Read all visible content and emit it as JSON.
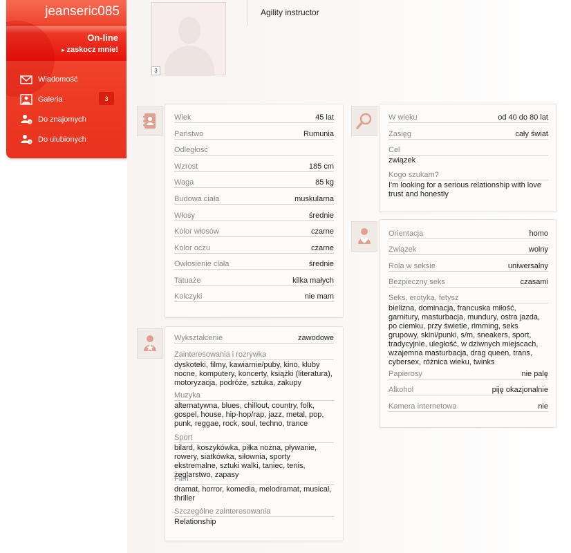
{
  "sidebar": {
    "username": "jeanseric085",
    "status": "On-line",
    "surprise_label": "zaskocz mnie!",
    "items": [
      {
        "label": "Wiadomość",
        "icon": "envelope-icon"
      },
      {
        "label": "Galeria",
        "icon": "picture-icon",
        "badge": "3"
      },
      {
        "label": "Do znajomych",
        "icon": "add-friend-icon"
      },
      {
        "label": "Do ulubionych",
        "icon": "add-favorite-icon"
      }
    ]
  },
  "profile": {
    "photo_count": "3",
    "headline": "Agility instructor"
  },
  "details": {
    "rows": [
      {
        "label": "Wiek",
        "value": "45 lat"
      },
      {
        "label": "Państwo",
        "value": "Rumunia"
      },
      {
        "label": "Odległość",
        "value": ""
      },
      {
        "label": "Wzrost",
        "value": "185 cm"
      },
      {
        "label": "Waga",
        "value": "85 kg"
      },
      {
        "label": "Budowa ciała",
        "value": "muskularna"
      },
      {
        "label": "Włosy",
        "value": "średnie"
      },
      {
        "label": "Kolor włosów",
        "value": "czarne"
      },
      {
        "label": "Kolor oczu",
        "value": "czarne"
      },
      {
        "label": "Owłosienie ciała",
        "value": "średnie"
      },
      {
        "label": "Tatuaże",
        "value": "kilka małych"
      },
      {
        "label": "Kolczyki",
        "value": "nie mam"
      }
    ]
  },
  "search": {
    "age_label": "W wieku",
    "age_value": "od 40 do 80 lat",
    "range_label": "Zasięg",
    "range_value": "cały świat",
    "goal_label": "Cel",
    "goal_value": "związek",
    "looking_label": "Kogo szukam?",
    "looking_value": "I'm looking for a serious relationship with love trust and honestly"
  },
  "sexuality": {
    "orientation_label": "Orientacja",
    "orientation_value": "homo",
    "relationship_label": "Związek",
    "relationship_value": "wolny",
    "role_label": "Rola w seksie",
    "role_value": "uniwersalny",
    "safe_label": "Bezpieczny seks",
    "safe_value": "czasami",
    "fetish_label": "Seks, erotyka, fetysz",
    "fetish_value": "bielizna, dominacja, francuska miłość, garnitury, masturbacja, mundury, ostra jazda, po ciemku, przy świetle, rimming, seks grupowy, skini/punki, s/m, sneakers, sport, tradycyjnie, uległość, w dziwnych miejscach, wzajemna masturbacja, drag queen, trans, cybersex, różnica wieku, twinks",
    "cigarettes_label": "Papierosy",
    "cigarettes_value": "nie palę",
    "alcohol_label": "Alkohol",
    "alcohol_value": "piję okazjonalnie",
    "webcam_label": "Kamera internetowa",
    "webcam_value": "nie"
  },
  "interests": {
    "education_label": "Wykształcenie",
    "education_value": "zawodowe",
    "hobbies_label": "Zainteresowania i rozrywka",
    "hobbies_value": "dyskoteki, filmy, kawiarnie/puby, kino, kluby nocne, komputery, koncerty, książki (literatura), motoryzacja, podróże, sztuka, zakupy",
    "music_label": "Muzyka",
    "music_value": "alternatywna, blues, chillout, country, folk, gospel, house, hip-hop/rap, jazz, metal, pop, punk, reggae, rock, soul, techno, trance",
    "sport_label": "Sport",
    "sport_value": "bilard, koszykówka, piłka nożna, pływanie, rowery, siatkówka, siłownia, sporty ekstremalne, sztuki walki, taniec, tenis, żeglarstwo, zapasy",
    "film_label": "Film",
    "film_value": "dramat, horror, komedia, melodramat, musical, thriller",
    "special_label": "Szczególne zainteresowania",
    "special_value": "Relationship"
  }
}
